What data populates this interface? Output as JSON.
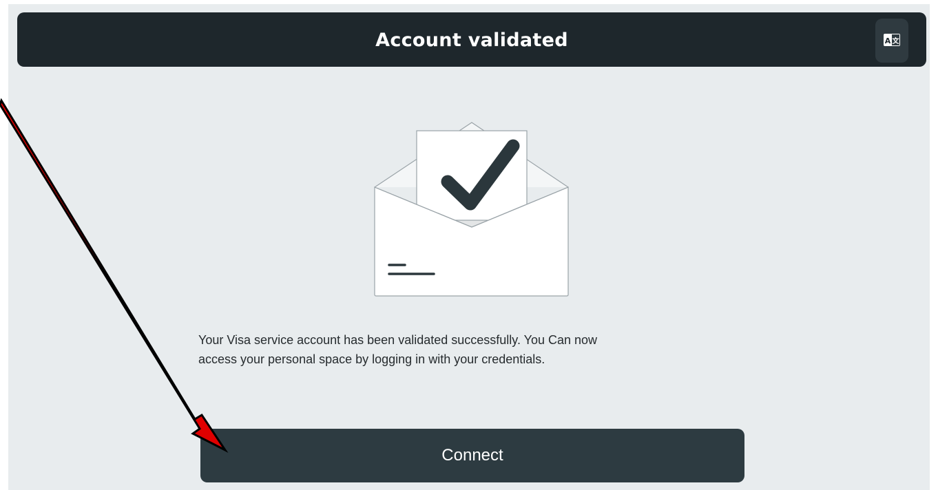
{
  "header": {
    "title": "Account validated",
    "translate_icon": "translate-icon"
  },
  "illustration": {
    "icon": "envelope-checkmark-icon"
  },
  "message": {
    "line1": "Your Visa service account has been validated successfully. You Can now",
    "line2": "access your personal space by logging in with your credentials."
  },
  "actions": {
    "connect_label": "Connect"
  },
  "annotation": {
    "icon": "red-arrow-icon",
    "color": "#e00000"
  },
  "colors": {
    "header_bg": "#1e272c",
    "panel_bg": "#e8ecee",
    "button_bg": "#2d3b41",
    "text": "#262b2e"
  }
}
